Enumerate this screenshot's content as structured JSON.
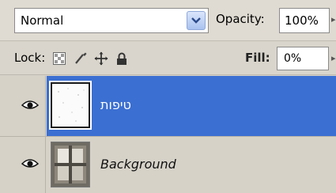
{
  "blend_mode": {
    "value": "Normal"
  },
  "opacity": {
    "label": "Opacity:",
    "value": "100%"
  },
  "lock": {
    "label": "Lock:"
  },
  "fill": {
    "label": "Fill:",
    "value": "0%"
  },
  "layers": [
    {
      "name": "טיפות",
      "visible": true,
      "selected": true
    },
    {
      "name": "Background",
      "visible": true,
      "selected": false,
      "locked": true
    }
  ],
  "colors": {
    "selection": "#3b6fd1",
    "panel": "#d6d2c8"
  }
}
